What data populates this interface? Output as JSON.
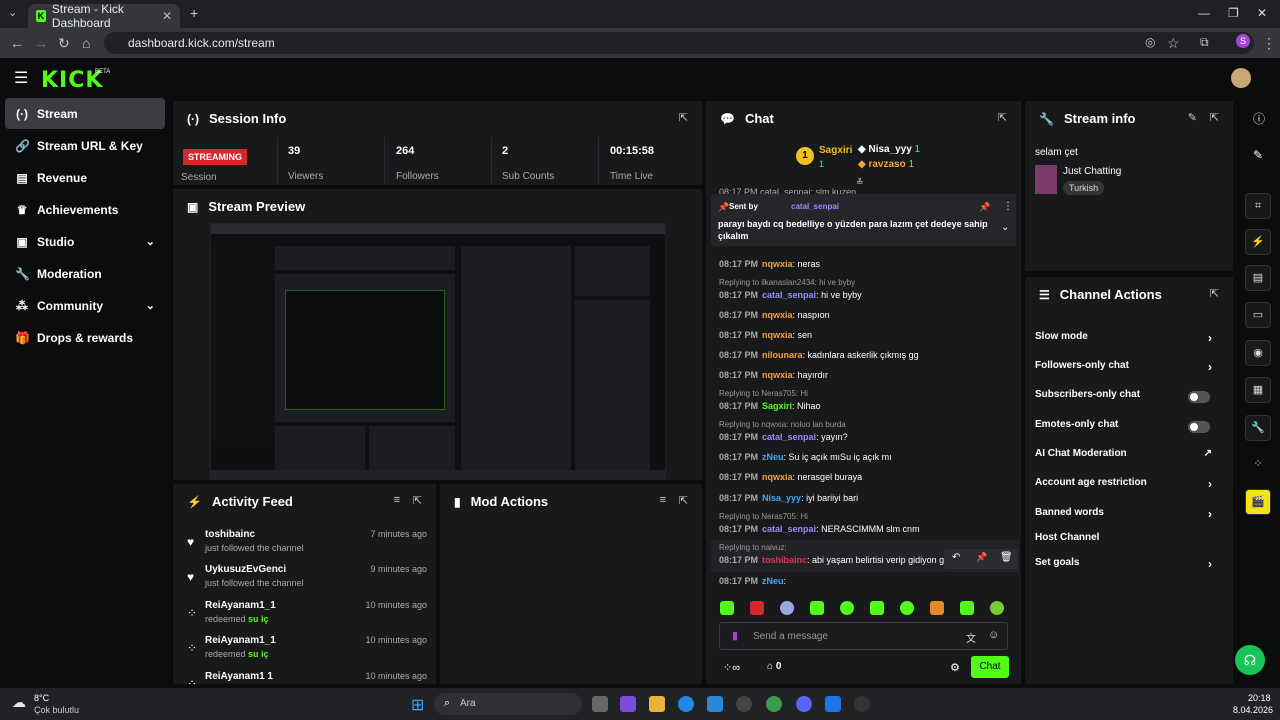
{
  "browser": {
    "tab_title": "Stream - Kick Dashboard",
    "url": "dashboard.kick.com/stream"
  },
  "app": {
    "logo": "KICK",
    "beta": "BETA"
  },
  "sidebar": {
    "items": [
      {
        "label": "Stream",
        "icon": "broadcast-icon"
      },
      {
        "label": "Stream URL & Key",
        "icon": "link-icon"
      },
      {
        "label": "Revenue",
        "icon": "chart-icon"
      },
      {
        "label": "Achievements",
        "icon": "trophy-icon"
      },
      {
        "label": "Studio",
        "icon": "studio-icon"
      },
      {
        "label": "Moderation",
        "icon": "wrench-icon"
      },
      {
        "label": "Community",
        "icon": "community-icon"
      },
      {
        "label": "Drops & rewards",
        "icon": "gift-icon"
      }
    ]
  },
  "session": {
    "title": "Session Info",
    "status": "STREAMING",
    "session_label": "Session",
    "stats": [
      {
        "value": "39",
        "label": "Viewers"
      },
      {
        "value": "264",
        "label": "Followers"
      },
      {
        "value": "2",
        "label": "Sub Counts"
      },
      {
        "value": "00:15:58",
        "label": "Time Live"
      }
    ]
  },
  "preview": {
    "title": "Stream Preview"
  },
  "activity": {
    "title": "Activity Feed",
    "items": [
      {
        "name": "toshibainc",
        "desc": "just followed the channel",
        "time": "7 minutes ago",
        "icon": "heart-icon"
      },
      {
        "name": "UykusuzEvGenci",
        "desc": "just followed the channel",
        "time": "9 minutes ago",
        "icon": "heart-icon"
      },
      {
        "name": "ReiAyanam1_1",
        "desc": "redeemed",
        "reward": "su iç",
        "time": "10 minutes ago",
        "icon": "points-icon"
      },
      {
        "name": "ReiAyanam1_1",
        "desc": "redeemed",
        "reward": "su iç",
        "time": "10 minutes ago",
        "icon": "points-icon"
      },
      {
        "name": "ReiAyanam1 1",
        "desc": "",
        "time": "10 minutes ago",
        "icon": "points-icon"
      }
    ]
  },
  "mod": {
    "title": "Mod Actions"
  },
  "chat": {
    "title": "Chat",
    "top": [
      {
        "name": "Sagxiri",
        "count": "1"
      },
      {
        "name": "Nisa_yyy",
        "count": "1"
      },
      {
        "name": "ravzaso",
        "count": "1"
      }
    ],
    "pinned": {
      "sent_by": "Sent by",
      "user": "catal_senpai",
      "text": "parayı baydı cq bedelliye o yüzden para lazım çet dedeye sahip çıkalım"
    },
    "partial": "08:17 PM  catal_senpai: slm kuzen",
    "messages": [
      {
        "time": "08:17 PM",
        "user": "nqwxia",
        "color": "#f2a33a",
        "text": ": neras"
      },
      {
        "reply": "Replying to ilkanaslan2434: hi ve byby",
        "time": "08:17 PM",
        "user": "catal_senpai",
        "color": "#9b8cff",
        "text": ": hi ve byby"
      },
      {
        "time": "08:17 PM",
        "user": "nqwxia",
        "color": "#f2a33a",
        "text": ": naspıon"
      },
      {
        "time": "08:17 PM",
        "user": "nqwxia",
        "color": "#f2a33a",
        "text": ": sen"
      },
      {
        "time": "08:17 PM",
        "user": "nilounara",
        "color": "#f2a33a",
        "text": ": kadınlara askerlik çıkmış gg"
      },
      {
        "time": "08:17 PM",
        "user": "nqwxia",
        "color": "#f2a33a",
        "text": ": hayırdır"
      },
      {
        "reply": "Replying to Neras705: Hi",
        "time": "08:17 PM",
        "user": "Sagxiri",
        "color": "#53fc18",
        "text": ": Nihao"
      },
      {
        "reply": "Replying to nqwxia: noluo lan burda",
        "time": "08:17 PM",
        "user": "catal_senpai",
        "color": "#9b8cff",
        "text": ": yayın?"
      },
      {
        "time": "08:17 PM",
        "user": "zNeu",
        "color": "#3fa9f5",
        "text": ": Su iç açık mıSu iç açık mı"
      },
      {
        "time": "08:17 PM",
        "user": "nqwxia",
        "color": "#f2a33a",
        "text": ": nerasgel buraya"
      },
      {
        "time": "08:17 PM",
        "user": "Nisa_yyy",
        "color": "#3fa9f5",
        "text": ": iyi bariiyi bari"
      },
      {
        "reply": "Replying to Neras705: Hi",
        "time": "08:17 PM",
        "user": "catal_senpai",
        "color": "#9b8cff",
        "text": ": NERASCIMMM slm cnm"
      },
      {
        "reply": "Replying to naivuz:",
        "time": "08:17 PM",
        "user": "toshibainc",
        "color": "#e0335a",
        "text": ": abi yaşam belirtisi verip gidiyon ga"
      },
      {
        "time": "08:17 PM",
        "user": "zNeu",
        "color": "#3fa9f5",
        "text": ":"
      }
    ],
    "input_placeholder": "Send a message",
    "points": "0",
    "send_label": "Chat"
  },
  "stream_info": {
    "title": "Stream info",
    "stream_title": "selam çet",
    "category": "Just Chatting",
    "tag": "Turkish"
  },
  "channel_actions": {
    "title": "Channel Actions",
    "items": [
      {
        "label": "Slow mode",
        "kind": "chevron"
      },
      {
        "label": "Followers-only chat",
        "kind": "chevron"
      },
      {
        "label": "Subscribers-only chat",
        "kind": "toggle"
      },
      {
        "label": "Emotes-only chat",
        "kind": "toggle"
      },
      {
        "label": "AI Chat Moderation",
        "kind": "external"
      },
      {
        "label": "Account age restriction",
        "kind": "chevron"
      },
      {
        "label": "Banned words",
        "kind": "chevron"
      },
      {
        "label": "Host Channel",
        "kind": "none"
      },
      {
        "label": "Set goals",
        "kind": "chevron"
      }
    ]
  },
  "taskbar": {
    "temp": "8°C",
    "weather": "Çok bulutlu",
    "search": "Ara",
    "time": "20:18",
    "date": "8.04.2026"
  },
  "colors": {
    "accent": "#53fc18",
    "panel": "#18191b",
    "bg": "#0b0c0d",
    "live": "#d6272d"
  }
}
